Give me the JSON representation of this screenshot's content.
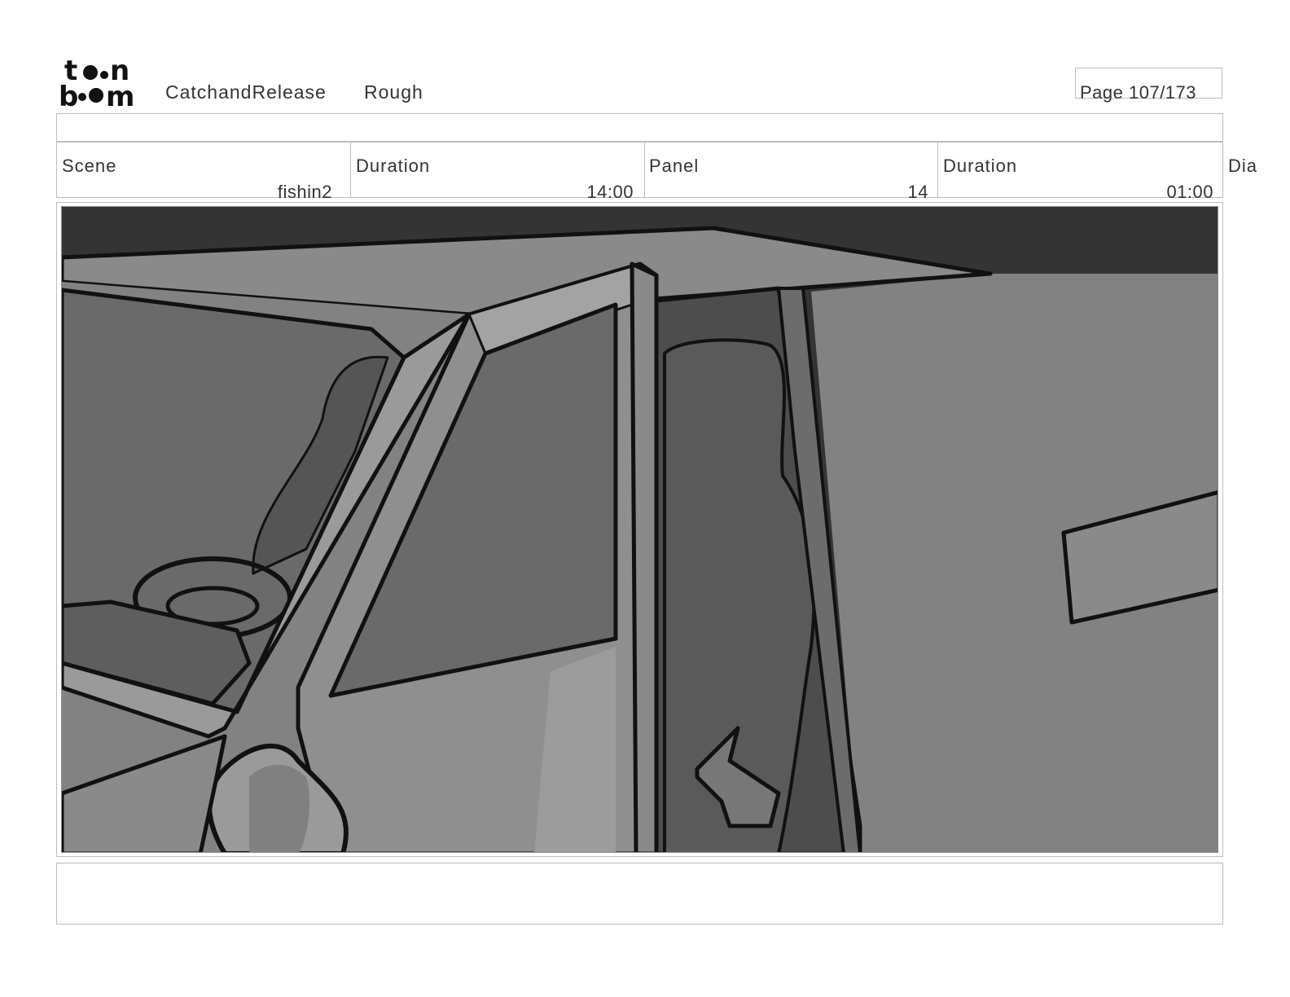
{
  "header": {
    "logo_text": "toon boom",
    "project": "CatchandRelease",
    "stage": "Rough",
    "page": "Page 107/173"
  },
  "info": {
    "scene_label": "Scene",
    "scene_value": "fishin2",
    "scene_duration_label": "Duration",
    "scene_duration_value": "14:00",
    "panel_label": "Panel",
    "panel_value": "14",
    "panel_duration_label": "Duration",
    "panel_duration_value": "01:00",
    "dialog_label": "Dia"
  },
  "image": {
    "description_icon": "storyboard-drawing-truck-cab-open-door",
    "palette": {
      "sky": "#343434",
      "roof": "#8a8a8a",
      "body": "#828282",
      "glass": "#6a6a6a",
      "interior": "#4d4d4d",
      "highlight": "#a3a3a3",
      "line": "#111111"
    }
  }
}
